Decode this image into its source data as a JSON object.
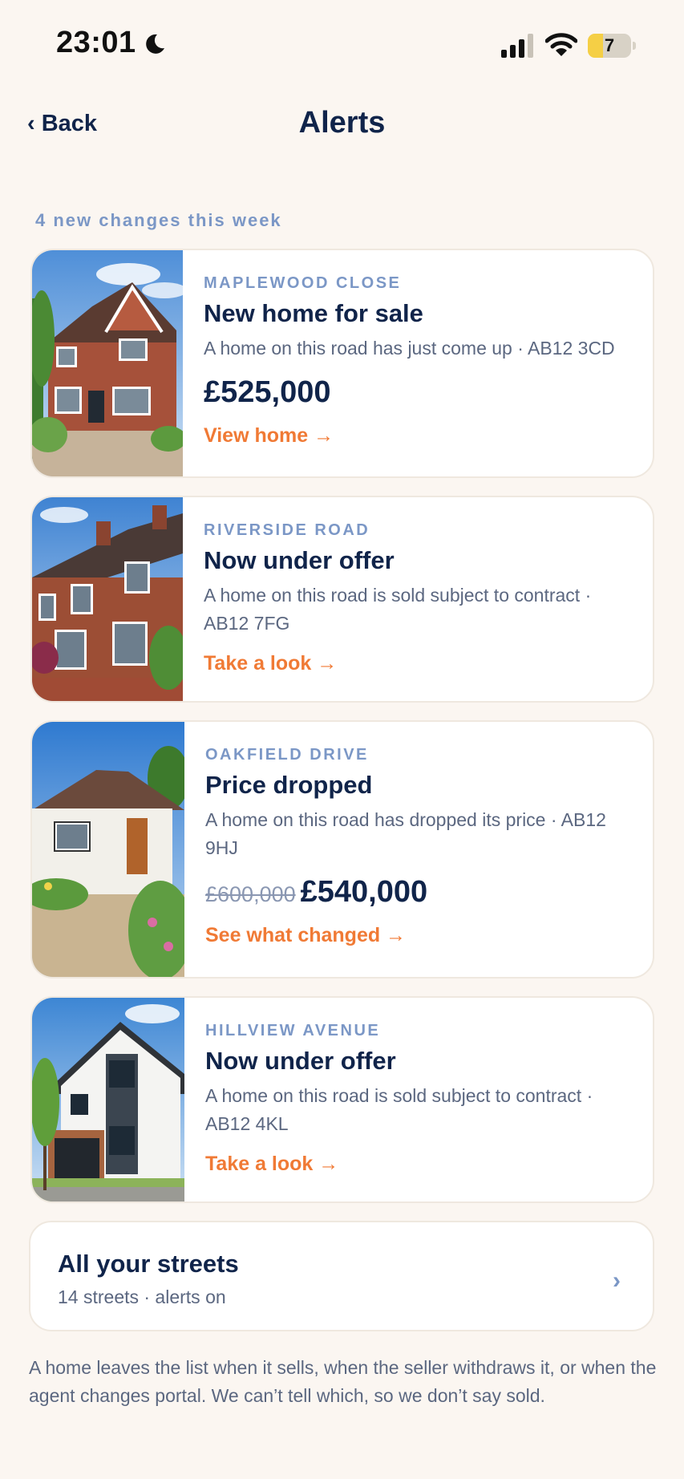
{
  "status_bar": {
    "time": "23:01",
    "battery": "7",
    "battery_level": 0.07
  },
  "nav": {
    "back_label": "‹ Back",
    "title": "Alerts"
  },
  "section_label": "4 new changes this week",
  "alerts": [
    {
      "street": "MAPLEWOOD CLOSE",
      "headline": "New home for sale",
      "description": "A home on this road has just come up · AB12 3CD",
      "price": "£525,000",
      "action": "View home →",
      "image": "red-brick-detached-house-photo"
    },
    {
      "street": "RIVERSIDE ROAD",
      "headline": "Now under offer",
      "description": "A home on this road is sold subject to contract · AB12 7FG",
      "action": "Take a look →",
      "image": "terraced-brick-houses-photo"
    },
    {
      "street": "OAKFIELD DRIVE",
      "headline": "Price dropped",
      "description": "A home on this road has dropped its price · AB12 9HJ",
      "old_price": "£600,000",
      "price": "£540,000",
      "action": "See what changed →",
      "image": "white-bungalow-photo"
    },
    {
      "street": "HILLVIEW AVENUE",
      "headline": "Now under offer",
      "description": "A home on this road is sold subject to contract · AB12 4KL",
      "action": "Take a look →",
      "image": "modern-white-house-photo"
    }
  ],
  "all_streets": {
    "title": "All your streets",
    "subtitle": "14 streets · alerts on",
    "chevron": "›"
  },
  "footnote": "A home leaves the list when it sells, when the seller withdraws it, or when the agent changes portal. We can’t tell which, so we don’t say sold.",
  "colors": {
    "background": "#fbf6f1",
    "navy": "#10244a",
    "accent": "#f07a35",
    "muted_blue": "#7b97c6"
  }
}
